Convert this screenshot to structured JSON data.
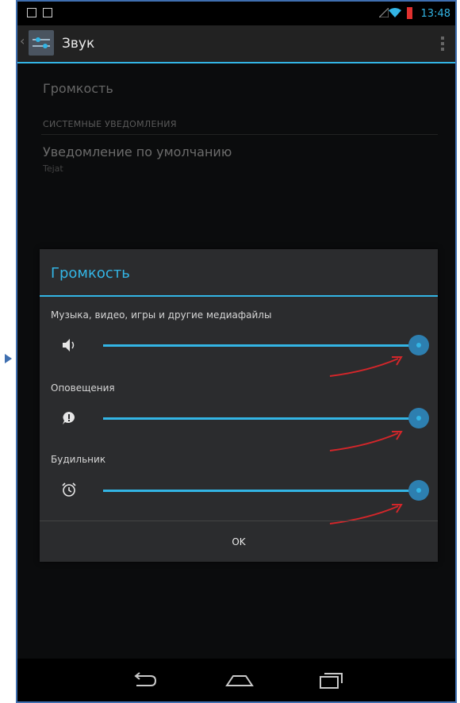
{
  "status_bar": {
    "time": "13:48",
    "accent_color": "#33b5e5"
  },
  "action_bar": {
    "title": "Звук",
    "back_icon": "chevron-left-icon",
    "app_icon": "settings-sound-icon",
    "menu_icon": "overflow-menu-icon"
  },
  "settings": {
    "volume_item": "Громкость",
    "section_header": "СИСТЕМНЫЕ УВЕДОМЛЕНИЯ",
    "notification_item": {
      "title": "Уведомление по умолчанию",
      "summary": "Tejat"
    }
  },
  "dialog": {
    "title": "Громкость",
    "rows": [
      {
        "label": "Музыка, видео, игры и другие медиафайлы",
        "icon": "speaker-icon",
        "level": 1.0
      },
      {
        "label": "Оповещения",
        "icon": "notification-bubble-icon",
        "level": 1.0
      },
      {
        "label": "Будильник",
        "icon": "alarm-clock-icon",
        "level": 1.0
      }
    ],
    "ok_label": "OK"
  },
  "nav_bar": {
    "icons": [
      "back-icon",
      "home-icon",
      "recent-apps-icon"
    ]
  },
  "annotation_color": "#d3262a"
}
